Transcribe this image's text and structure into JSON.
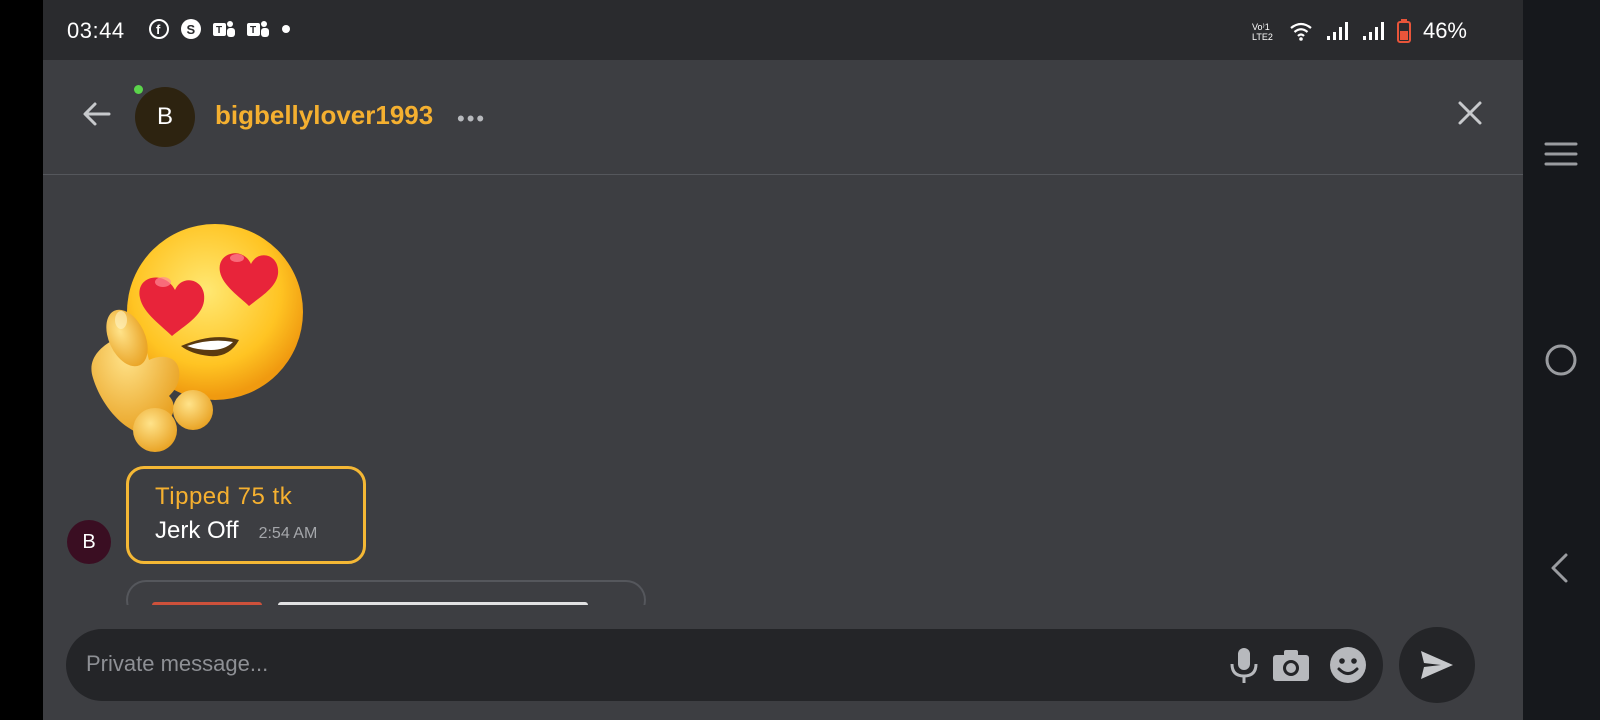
{
  "status_bar": {
    "time": "03:44",
    "notification_icons": [
      "facebook-icon",
      "skype-icon",
      "teams-icon",
      "teams-icon",
      "dot"
    ],
    "battery": "46%",
    "network_label": "Vo LTE2"
  },
  "header": {
    "avatar_letter": "B",
    "username": "bigbellylover1993",
    "more_label": "•••"
  },
  "messages": {
    "avatar_letter": "B",
    "tip_title": "Tipped 75 tk",
    "tip_text": "Jerk Off",
    "tip_time": "2:54 AM"
  },
  "composer": {
    "placeholder": "Private message..."
  },
  "colors": {
    "accent": "#f5b030",
    "background": "#3d3e42",
    "online": "#5bd44b"
  }
}
